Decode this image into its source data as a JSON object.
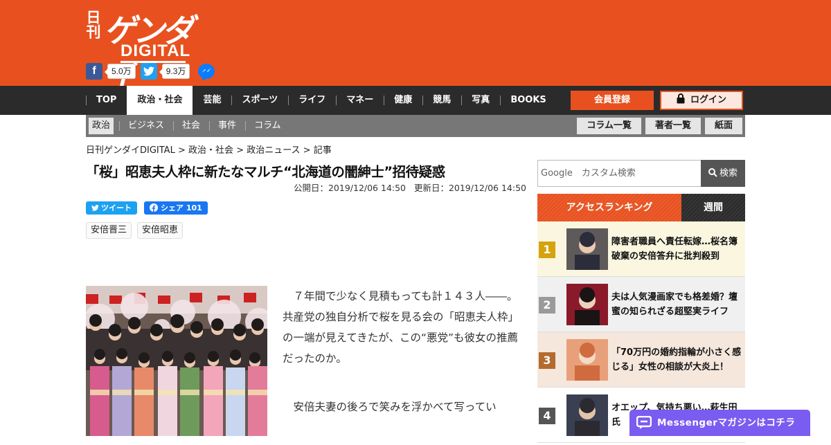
{
  "logo": {
    "nikkan": "日刊",
    "gendai": "ゲンダイ",
    "digital": "DIGITAL"
  },
  "social": {
    "facebook_count": "5.0万",
    "twitter_count": "9.3万"
  },
  "mainnav": {
    "items": [
      "TOP",
      "政治・社会",
      "芸能",
      "スポーツ",
      "ライフ",
      "マネー",
      "健康",
      "競馬",
      "写真",
      "BOOKS"
    ],
    "active": "政治・社会",
    "register": "会員登録",
    "login": "ログイン"
  },
  "subnav": {
    "items": [
      "政治",
      "ビジネス",
      "社会",
      "事件",
      "コラム"
    ],
    "buttons": [
      "コラム一覧",
      "著者一覧",
      "紙面"
    ]
  },
  "breadcrumb": [
    "日刊ゲンダイDIGITAL",
    "政治・社会",
    "政治ニュース",
    "記事"
  ],
  "article": {
    "title": "「桜」昭恵夫人枠に新たなマルチ“北海道の闇紳士”招待疑惑",
    "published_label": "公開日：",
    "published": "2019/12/06 14:50",
    "updated_label": "更新日：",
    "updated": "2019/12/06 14:50",
    "tweet": "ツイート",
    "share": "シェア",
    "share_count": "101",
    "tags": [
      "安倍晋三",
      "安倍昭恵"
    ],
    "paragraphs": [
      "７年間で少なく見積もっても計１４３人――。共産党の独自分析で桜を見る会の「昭恵夫人枠」の一端が見えてきたが、この“悪党”も彼女の推薦だったのか。",
      "安倍夫妻の後ろで笑みを浮かべて写ってい"
    ]
  },
  "sidebar": {
    "search": {
      "brand": "Google",
      "placeholder": "カスタム検索",
      "button": "検索"
    },
    "ranking_tabs": [
      "アクセスランキング",
      "週間"
    ],
    "ranking": [
      {
        "rank": "1",
        "color": "#d4a30e",
        "bg": "#fbf6df",
        "text": "障害者職員へ責任転嫁…桜名簿破棄の安倍答弁に批判殺到"
      },
      {
        "rank": "2",
        "color": "#9a9a9a",
        "bg": "#f0f0f0",
        "text": "夫は人気漫画家でも格差婚？壇蜜の知られざる超堅実ライフ"
      },
      {
        "rank": "3",
        "color": "#b36b2f",
        "bg": "#f5e7dc",
        "text": "「70万円の婚約指輪が小さく感じる」女性の相談が大炎上！"
      },
      {
        "rank": "4",
        "color": "#555555",
        "bg": "#ffffff",
        "text": "オエップ、気持ち悪い…萩生田氏"
      }
    ]
  },
  "messenger": "Messengerマガジンはコチラ",
  "colors": {
    "brand": "#e8511f",
    "nav": "#2b2b2b",
    "subnav": "#777777",
    "messenger": "#7a5cf0"
  }
}
